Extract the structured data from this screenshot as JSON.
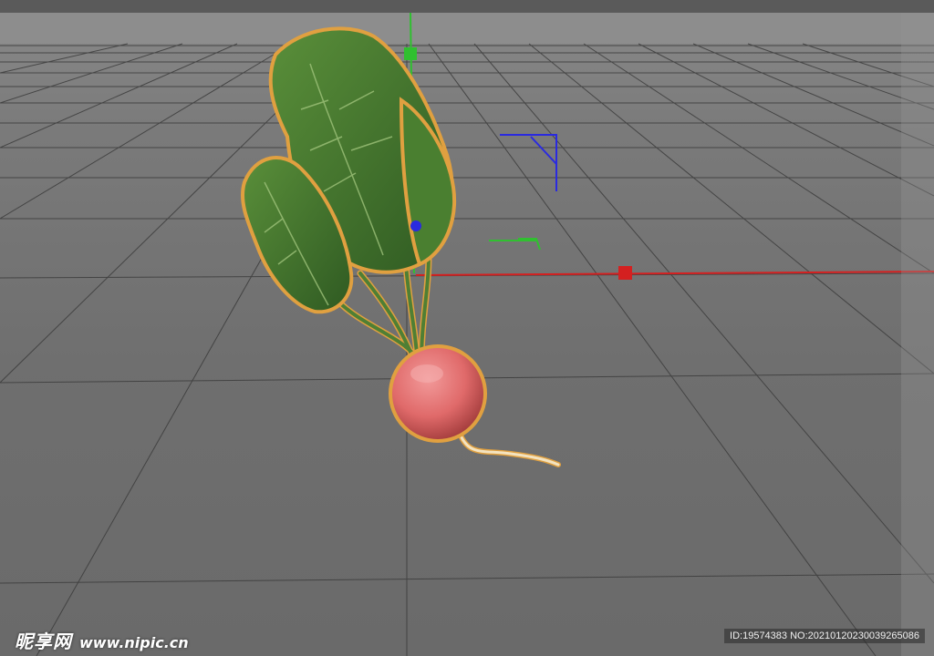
{
  "viewport": {
    "background": "#6f6f6f",
    "grid_color": "#3a3a3a"
  },
  "axes": {
    "x_color": "#e02020",
    "y_color": "#30c030",
    "z_color": "#2a2ae0"
  },
  "object": {
    "name": "radish",
    "selection_outline_color": "#e0a040",
    "root_color": "#e06a6a",
    "leaf_color": "#3f7a2a"
  },
  "watermark": {
    "brand": "昵享网",
    "url": "www.nipic.cn",
    "id_text": "ID:19574383 NO:20210120230039265086"
  }
}
